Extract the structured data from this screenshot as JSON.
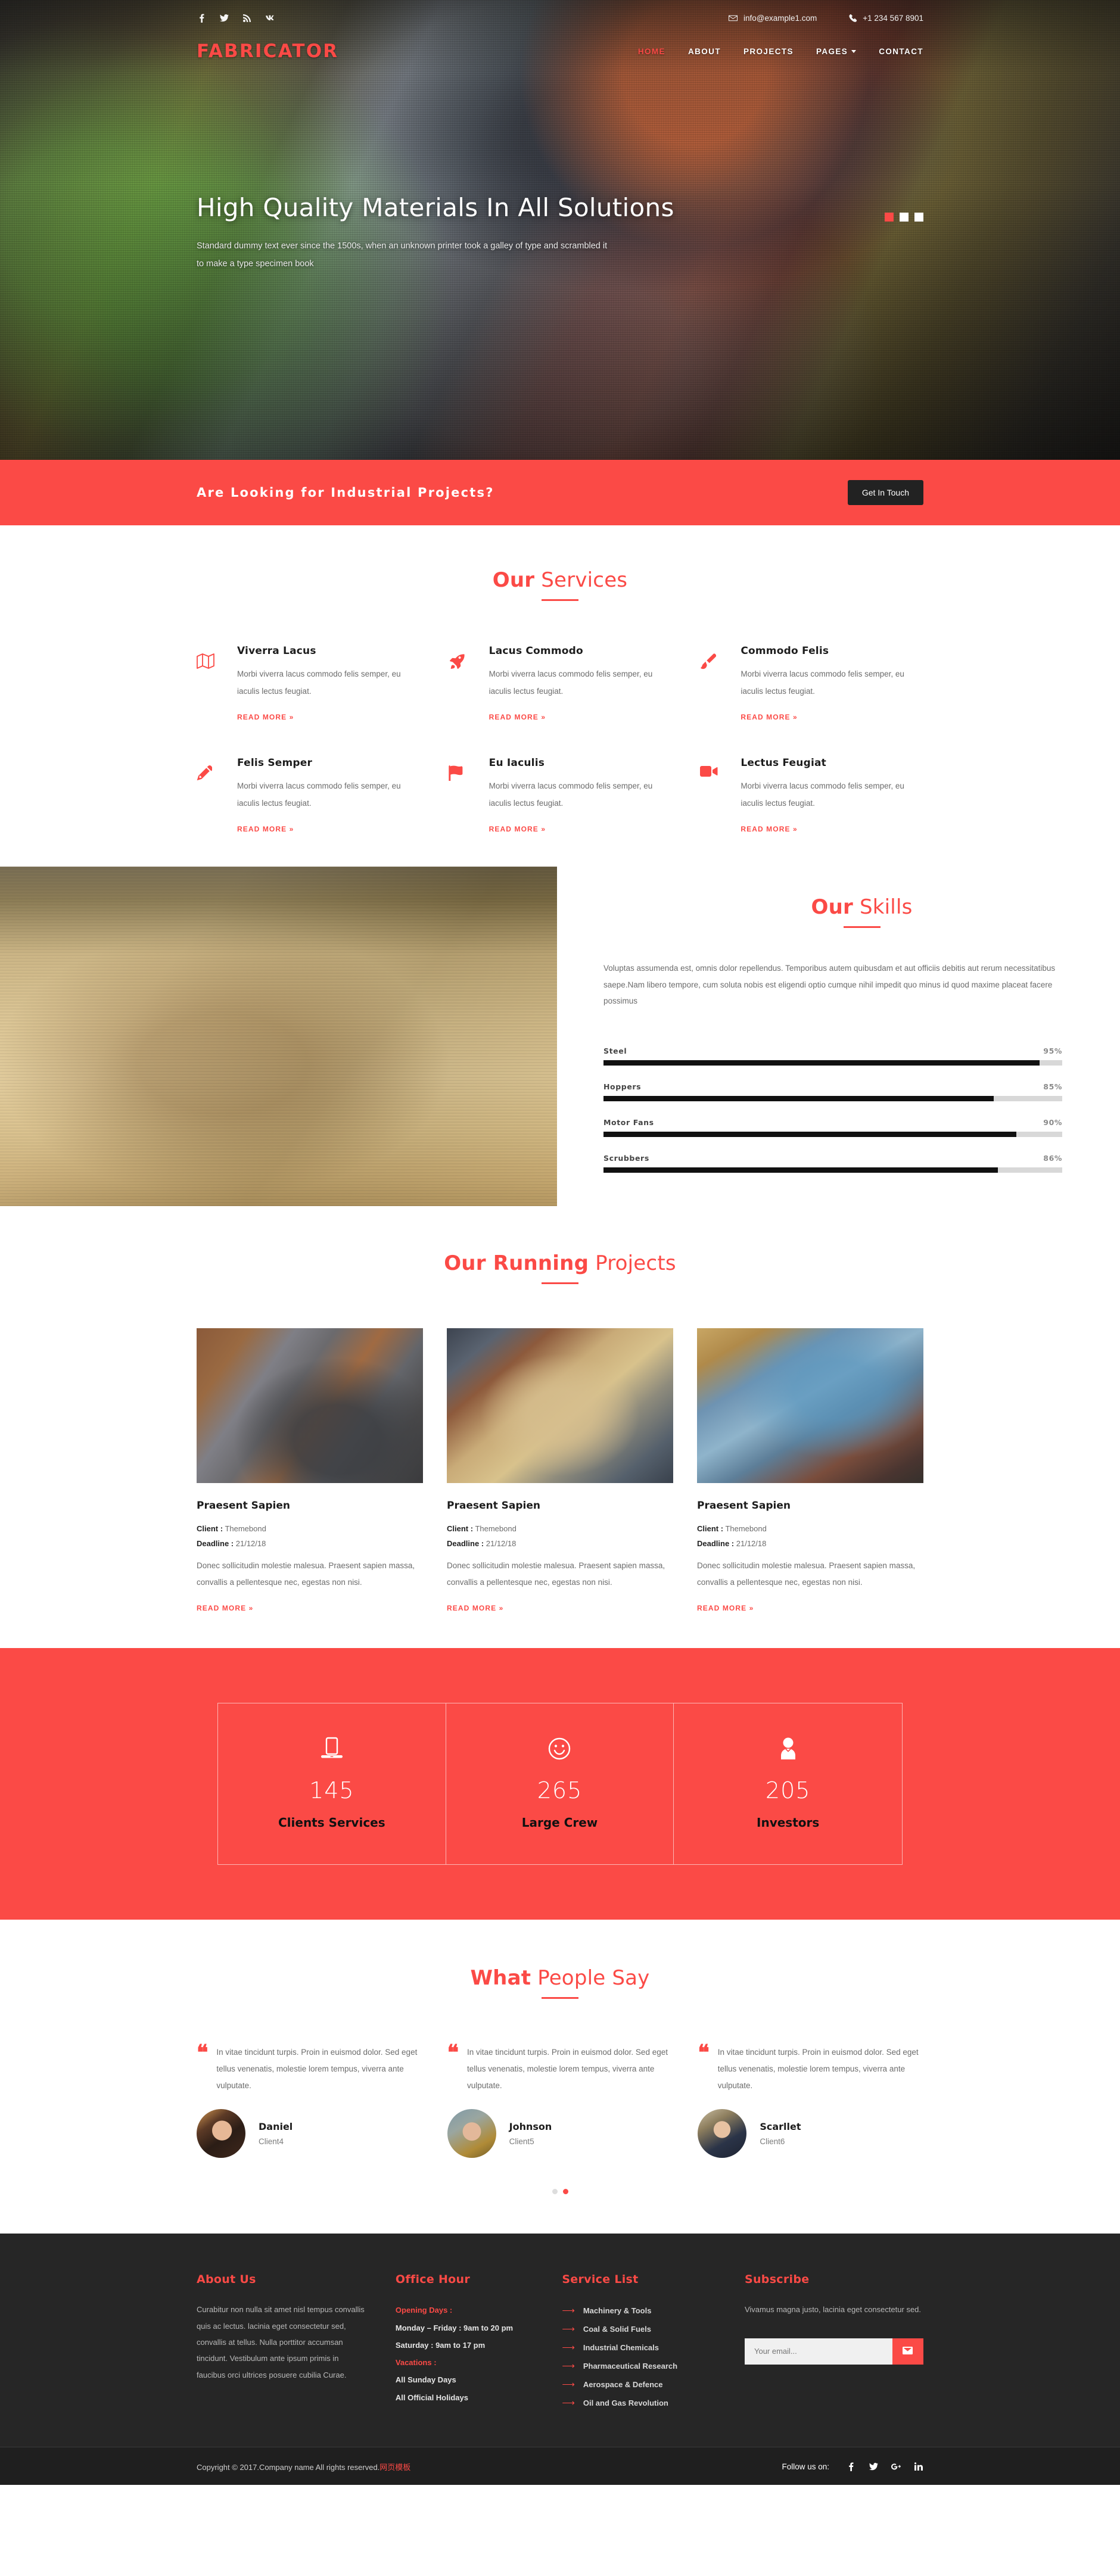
{
  "topbar": {
    "social": [
      {
        "name": "facebook-icon",
        "glyph": "f"
      },
      {
        "name": "twitter-icon",
        "glyph": "ᵛ"
      },
      {
        "name": "rss-icon",
        "glyph": "◔"
      },
      {
        "name": "vk-icon",
        "glyph": "vk"
      }
    ],
    "email": "info@example1.com",
    "phone": "+1 234 567 8901"
  },
  "nav": {
    "logo": "FABRICATOR",
    "items": [
      {
        "label": "HOME",
        "active": true
      },
      {
        "label": "ABOUT",
        "active": false
      },
      {
        "label": "PROJECTS",
        "active": false
      },
      {
        "label": "PAGES",
        "active": false,
        "caret": true
      },
      {
        "label": "CONTACT",
        "active": false
      }
    ]
  },
  "hero": {
    "title": "High Quality Materials In All Solutions",
    "subtitle": "Standard dummy text ever since the 1500s, when an unknown printer took a galley of type and scrambled it to make a type specimen book",
    "slides": 3,
    "active_slide": 1
  },
  "cta": {
    "title": "Are Looking for Industrial Projects?",
    "button": "Get In Touch"
  },
  "services": {
    "heading_bold": "Our",
    "heading_light": "Services",
    "read_more": "READ MORE »",
    "items": [
      {
        "icon": "map-icon",
        "title": "Viverra Lacus",
        "text": "Morbi viverra lacus commodo felis semper, eu iaculis lectus feugiat."
      },
      {
        "icon": "rocket-icon",
        "title": "Lacus Commodo",
        "text": "Morbi viverra lacus commodo felis semper, eu iaculis lectus feugiat."
      },
      {
        "icon": "paintbrush-icon",
        "title": "Commodo Felis",
        "text": "Morbi viverra lacus commodo felis semper, eu iaculis lectus feugiat."
      },
      {
        "icon": "pencil-icon",
        "title": "Felis Semper",
        "text": "Morbi viverra lacus commodo felis semper, eu iaculis lectus feugiat."
      },
      {
        "icon": "flag-icon",
        "title": "Eu Iaculis",
        "text": "Morbi viverra lacus commodo felis semper, eu iaculis lectus feugiat."
      },
      {
        "icon": "video-icon",
        "title": "Lectus Feugiat",
        "text": "Morbi viverra lacus commodo felis semper, eu iaculis lectus feugiat."
      }
    ]
  },
  "skills": {
    "heading_bold": "Our",
    "heading_light": "Skills",
    "intro": "Voluptas assumenda est, omnis dolor repellendus. Temporibus autem quibusdam et aut officiis debitis aut rerum necessitatibus saepe.Nam libero tempore, cum soluta nobis est eligendi optio cumque nihil impedit quo minus id quod maxime placeat facere possimus",
    "bars": [
      {
        "label": "Steel",
        "pct_label": "95%",
        "value": 95
      },
      {
        "label": "Hoppers",
        "pct_label": "85%",
        "value": 85
      },
      {
        "label": "Motor Fans",
        "pct_label": "90%",
        "value": 90
      },
      {
        "label": "Scrubbers",
        "pct_label": "86%",
        "value": 86
      }
    ]
  },
  "projects": {
    "heading_bold": "Our Running",
    "heading_light": "Projects",
    "read_more": "READ MORE »",
    "client_label": "Client :",
    "deadline_label": "Deadline :",
    "items": [
      {
        "title": "Praesent Sapien",
        "client": "Themebond",
        "deadline": "21/12/18",
        "text": "Donec sollicitudin molestie malesua. Praesent sapien massa, convallis a pellentesque nec, egestas non nisi."
      },
      {
        "title": "Praesent Sapien",
        "client": "Themebond",
        "deadline": "21/12/18",
        "text": "Donec sollicitudin molestie malesua. Praesent sapien massa, convallis a pellentesque nec, egestas non nisi."
      },
      {
        "title": "Praesent Sapien",
        "client": "Themebond",
        "deadline": "21/12/18",
        "text": "Donec sollicitudin molestie malesua. Praesent sapien massa, convallis a pellentesque nec, egestas non nisi."
      }
    ]
  },
  "counters": [
    {
      "icon": "laptop-icon",
      "value": "145",
      "label": "Clients Services"
    },
    {
      "icon": "smiley-icon",
      "value": "265",
      "label": "Large Crew"
    },
    {
      "icon": "user-icon",
      "value": "205",
      "label": "Investors"
    }
  ],
  "testimonials": {
    "heading_bold": "What",
    "heading_light": "People Say",
    "quote_mark": "❝",
    "items": [
      {
        "text": "In vitae tincidunt turpis. Proin in euismod dolor. Sed eget tellus venenatis, molestie lorem tempus, viverra ante vulputate.",
        "name": "Daniel",
        "role": "Client4"
      },
      {
        "text": "In vitae tincidunt turpis. Proin in euismod dolor. Sed eget tellus venenatis, molestie lorem tempus, viverra ante vulputate.",
        "name": "Johnson",
        "role": "Client5"
      },
      {
        "text": "In vitae tincidunt turpis. Proin in euismod dolor. Sed eget tellus venenatis, molestie lorem tempus, viverra ante vulputate.",
        "name": "Scarllet",
        "role": "Client6"
      }
    ],
    "dots": 2,
    "active_dot": 2
  },
  "footer": {
    "about": {
      "title": "About Us",
      "text": "Curabitur non nulla sit amet nisl tempus convallis quis ac lectus. lacinia eget consectetur sed, convallis at tellus. Nulla porttitor accumsan tincidunt. Vestibulum ante ipsum primis in faucibus orci ultrices posuere cubilia Curae."
    },
    "office": {
      "title": "Office Hour",
      "opening_label": "Opening Days :",
      "weekdays": "Monday – Friday : 9am to 20 pm",
      "saturday": "Saturday : 9am to 17 pm",
      "vacations_label": "Vacations :",
      "vac1": "All Sunday Days",
      "vac2": "All Official Holidays"
    },
    "services": {
      "title": "Service List",
      "items": [
        "Machinery & Tools",
        "Coal & Solid Fuels",
        "Industrial Chemicals",
        "Pharmaceutical Research",
        "Aerospace & Defence",
        "Oil and Gas Revolution"
      ]
    },
    "subscribe": {
      "title": "Subscribe",
      "text": "Vivamus magna justo, lacinia eget consectetur sed.",
      "placeholder": "Your email...",
      "button_icon": "envelope-icon"
    }
  },
  "copyright": {
    "text": "Copyright © 2017.Company name All rights reserved.",
    "link": "网页模板",
    "follow_label": "Follow us on:",
    "social": [
      {
        "name": "facebook-icon",
        "glyph": "f"
      },
      {
        "name": "twitter-icon",
        "glyph": "ᵛ"
      },
      {
        "name": "googleplus-icon",
        "glyph": "G+"
      },
      {
        "name": "linkedin-icon",
        "glyph": "in"
      }
    ]
  },
  "colors": {
    "accent": "#fb4a46",
    "dark": "#262626",
    "darker": "#1f1f1f"
  }
}
